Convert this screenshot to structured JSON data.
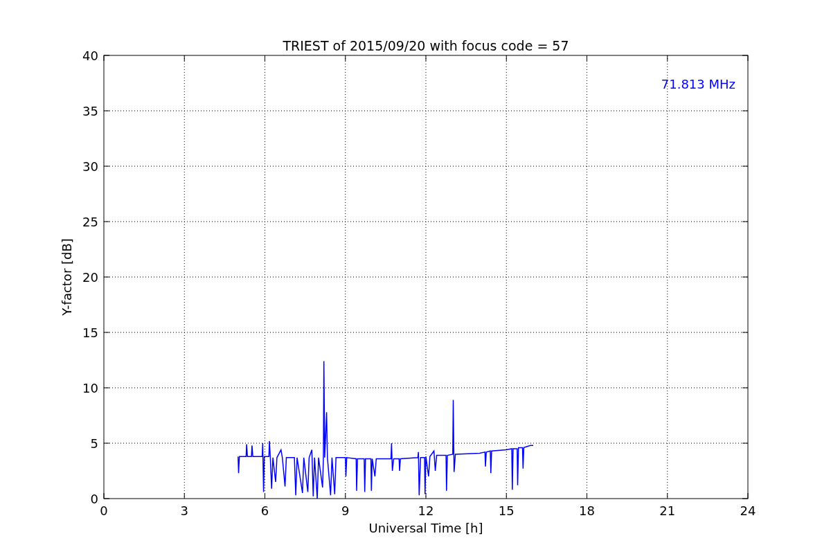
{
  "chart_data": {
    "type": "line",
    "title": "TRIEST of 2015/09/20 with focus code = 57",
    "xlabel": "Universal Time [h]",
    "ylabel": "Y-factor [dB]",
    "xlim": [
      0,
      24
    ],
    "ylim": [
      0,
      40
    ],
    "xticks": [
      0,
      3,
      6,
      9,
      12,
      15,
      18,
      21,
      24
    ],
    "yticks": [
      0,
      5,
      10,
      15,
      20,
      25,
      30,
      35,
      40
    ],
    "x": [
      5.0,
      5.02,
      5.05,
      5.3,
      5.32,
      5.35,
      5.5,
      5.52,
      5.55,
      5.9,
      5.92,
      5.95,
      5.98,
      6.15,
      6.17,
      6.2,
      6.25,
      6.3,
      6.4,
      6.45,
      6.6,
      6.65,
      6.75,
      6.8,
      7.1,
      7.15,
      7.2,
      7.4,
      7.45,
      7.6,
      7.65,
      7.75,
      7.8,
      7.85,
      7.95,
      8.0,
      8.15,
      8.18,
      8.2,
      8.23,
      8.3,
      8.33,
      8.45,
      8.5,
      8.6,
      8.65,
      9.0,
      9.02,
      9.05,
      9.4,
      9.42,
      9.45,
      9.7,
      9.72,
      9.75,
      9.95,
      9.97,
      10.0,
      10.1,
      10.15,
      10.7,
      10.72,
      10.75,
      10.8,
      11.0,
      11.02,
      11.05,
      11.7,
      11.72,
      11.75,
      11.8,
      11.95,
      11.97,
      12.0,
      12.1,
      12.15,
      12.3,
      12.35,
      12.4,
      12.75,
      12.77,
      12.8,
      13.0,
      13.02,
      13.05,
      13.1,
      14.0,
      14.2,
      14.22,
      14.25,
      14.4,
      14.42,
      14.45,
      15.0,
      15.2,
      15.22,
      15.25,
      15.4,
      15.42,
      15.45,
      15.6,
      15.62,
      15.65,
      15.9,
      16.0
    ],
    "series": [
      {
        "color": "#0000ff",
        "values": [
          3.8,
          2.3,
          3.8,
          3.8,
          4.9,
          3.8,
          3.8,
          4.8,
          3.8,
          3.8,
          5.0,
          0.6,
          3.8,
          3.8,
          5.2,
          3.8,
          0.9,
          3.7,
          1.5,
          3.7,
          4.4,
          3.7,
          1.1,
          3.7,
          3.7,
          0.3,
          3.7,
          0.5,
          3.7,
          0.6,
          3.7,
          4.4,
          0.2,
          3.7,
          0.0,
          3.7,
          1.0,
          3.7,
          12.4,
          3.7,
          7.8,
          3.7,
          0.3,
          3.7,
          0.4,
          3.7,
          3.7,
          2.0,
          3.7,
          3.6,
          0.7,
          3.6,
          3.6,
          0.6,
          3.6,
          3.6,
          0.7,
          3.6,
          2.0,
          3.6,
          3.6,
          5.0,
          2.5,
          3.6,
          3.6,
          2.5,
          3.6,
          3.7,
          4.2,
          0.3,
          3.7,
          3.7,
          0.4,
          3.8,
          2.0,
          3.8,
          4.3,
          2.5,
          3.9,
          3.9,
          0.7,
          3.9,
          4.0,
          8.9,
          2.4,
          4.0,
          4.1,
          4.2,
          2.9,
          4.2,
          4.3,
          2.3,
          4.3,
          4.4,
          4.5,
          0.8,
          4.5,
          4.5,
          1.2,
          4.6,
          4.6,
          2.7,
          4.6,
          4.8,
          4.8
        ]
      }
    ],
    "grid": true,
    "annotations": [
      {
        "text": "71.813 MHz"
      }
    ]
  }
}
